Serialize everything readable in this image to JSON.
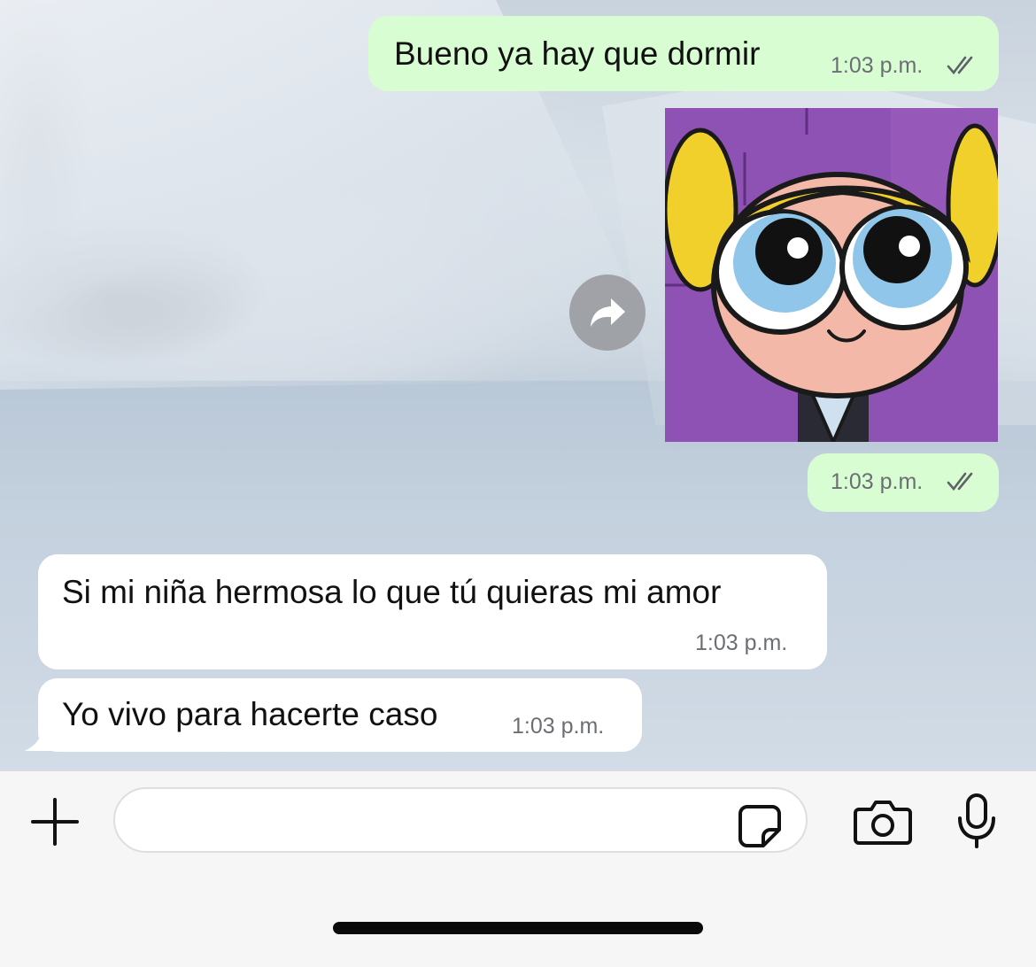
{
  "messages": [
    {
      "direction": "out",
      "text": "Bueno ya hay que dormir",
      "time": "1:03 p.m.",
      "status": "read-ticks"
    },
    {
      "direction": "out",
      "type": "image",
      "image": "bubbles-powerpuff-girl-sticker",
      "time": "1:03 p.m.",
      "status": "read-ticks"
    },
    {
      "direction": "in",
      "text": "Si mi niña hermosa lo que tú quieras mi amor",
      "time": "1:03 p.m."
    },
    {
      "direction": "in",
      "text": "Yo vivo para hacerte caso",
      "time": "1:03 p.m."
    }
  ],
  "icons": {
    "forward": "forward-arrow-icon",
    "attach": "plus-icon",
    "sticker": "sticker-icon",
    "camera": "camera-icon",
    "mic": "microphone-icon"
  },
  "input": {
    "value": "",
    "placeholder": ""
  },
  "colors": {
    "outgoing_bubble": "#d9fdd3",
    "incoming_bubble": "#ffffff",
    "ticks": "#5f6368"
  }
}
